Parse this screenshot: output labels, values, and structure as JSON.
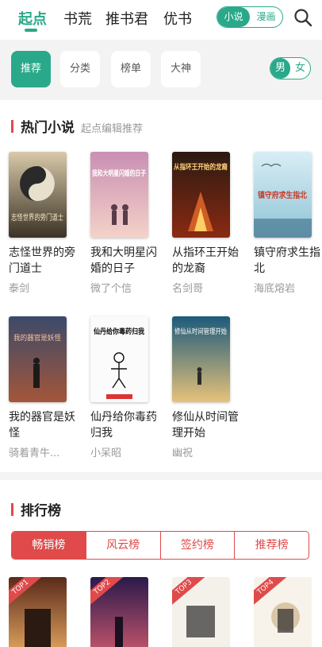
{
  "topnav": {
    "tabs": [
      "起点",
      "书荒",
      "推书君",
      "优书"
    ],
    "toggle": {
      "on": "小说",
      "off": "漫画"
    }
  },
  "pills": {
    "items": [
      "推荐",
      "分类",
      "榜单",
      "大神"
    ],
    "gender": {
      "on": "男",
      "off": "女"
    }
  },
  "hot": {
    "title": "热门小说",
    "subtitle": "起点编辑推荐",
    "books": [
      {
        "name": "志怪世界的旁门道士",
        "author": "泰剑",
        "cover_text": "志怪世界的旁门道士"
      },
      {
        "name": "我和大明星闪婚的日子",
        "author": "微了个信",
        "cover_text": "我和大明星闪婚的日子"
      },
      {
        "name": "从指环王开始的龙裔",
        "author": "名剑哥",
        "cover_text": "从指环王开始的龙裔"
      },
      {
        "name": "镇守府求生指北",
        "author": "海底熔岩",
        "cover_text": "镇守府求生指北"
      },
      {
        "name": "我的器官是妖怪",
        "author": "骑着青牛...",
        "cover_text": "我的器官是妖怪"
      },
      {
        "name": "仙丹给你毒药归我",
        "author": "小呆昭",
        "cover_text": "仙丹给你毒药归我"
      },
      {
        "name": "修仙从时间管理开始",
        "author": "幽祝",
        "cover_text": "修仙从时间管理开始"
      }
    ]
  },
  "rank": {
    "title": "排行榜",
    "tabs": [
      "畅销榜",
      "风云榜",
      "签约榜",
      "推荐榜"
    ],
    "badges": [
      "TOP1",
      "TOP2",
      "TOP3",
      "TOP4"
    ]
  },
  "colors": {
    "accent": "#2aa98a",
    "rank_red": "#e04a4a"
  }
}
